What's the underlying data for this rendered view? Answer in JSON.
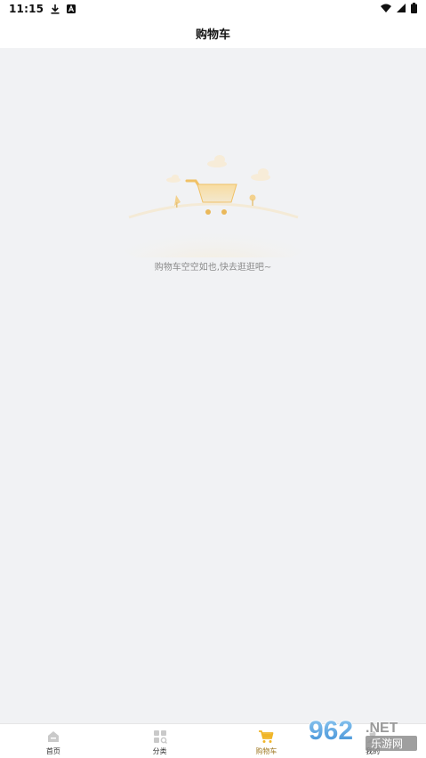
{
  "status_bar": {
    "time": "11:15",
    "left_icons": [
      "download-icon",
      "a-badge-icon"
    ],
    "right_icons": [
      "wifi-icon",
      "signal-icon",
      "battery-icon"
    ]
  },
  "header": {
    "title": "购物车"
  },
  "empty_state": {
    "illustration": "empty-cart-illustration",
    "message": "购物车空空如也,快去逛逛吧~"
  },
  "tabs": [
    {
      "label": "首页",
      "icon": "home-icon",
      "active": false
    },
    {
      "label": "分类",
      "icon": "category-icon",
      "active": false
    },
    {
      "label": "购物车",
      "icon": "cart-icon",
      "active": true
    },
    {
      "label": "我的",
      "icon": "user-icon",
      "active": false
    }
  ],
  "watermark": {
    "number": "962",
    "suffix": ".NET",
    "subtitle": "乐游网"
  },
  "colors": {
    "accent": "#f0b528",
    "active_label": "#a07a26",
    "background": "#f1f2f4"
  }
}
